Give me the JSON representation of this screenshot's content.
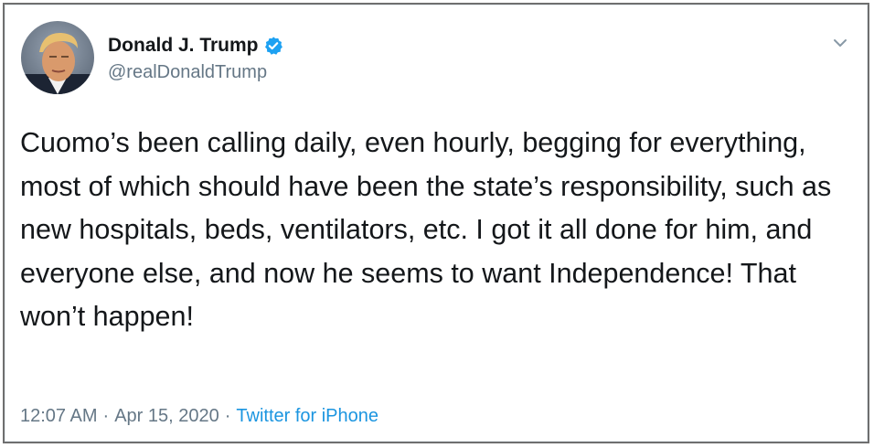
{
  "author": {
    "display_name": "Donald J. Trump",
    "handle": "@realDonaldTrump",
    "verified_icon": "verified-badge-icon",
    "avatar_icon": "profile-photo"
  },
  "tweet": {
    "text": "Cuomo’s been calling daily, even hourly, begging for everything, most of which should have been the state’s responsibility, such as new hospitals, beds, ventilators, etc. I got it all done for him, and everyone else, and now he seems to want Independence! That won’t happen!",
    "time": "12:07 AM",
    "separator": "·",
    "date": "Apr 15, 2020",
    "source": "Twitter for iPhone"
  },
  "colors": {
    "text": "#14171a",
    "secondary": "#657786",
    "link": "#1b95e0",
    "verified": "#1da1f2"
  },
  "menu": {
    "caret_icon": "chevron-down-icon"
  }
}
